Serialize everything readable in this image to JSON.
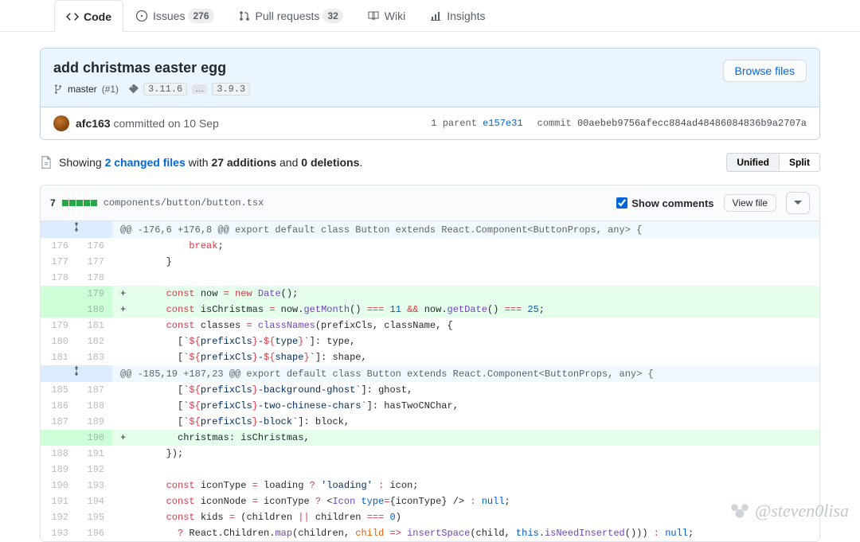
{
  "tabs": {
    "code": "Code",
    "issues": "Issues",
    "issues_count": "276",
    "pulls": "Pull requests",
    "pulls_count": "32",
    "wiki": "Wiki",
    "insights": "Insights"
  },
  "commit": {
    "title": "add christmas easter egg",
    "branch": "master",
    "branch_suffix": "(#1)",
    "tag1": "3.11.6",
    "tag_dots": "…",
    "tag2": "3.9.3",
    "browse_btn": "Browse files",
    "author": "afc163",
    "committed": "committed on 10 Sep",
    "parent_label": "1 parent",
    "parent_sha": "e157e31",
    "commit_label": "commit",
    "sha": "00aebeb9756afecc884ad48486084836b9a2707a"
  },
  "diffbar": {
    "showing": "Showing",
    "files": "2 changed files",
    "with": "with",
    "adds": "27 additions",
    "and": "and",
    "dels": "0 deletions",
    "dot": ".",
    "unified": "Unified",
    "split": "Split"
  },
  "file": {
    "stat": "7",
    "path": "components/button/button.tsx",
    "show_comments": "Show comments",
    "view_file": "View file"
  },
  "hunks": {
    "h1": "@@ -176,6 +176,8 @@ export default class Button extends React.Component<ButtonProps, any> {",
    "h2": "@@ -185,19 +187,23 @@ export default class Button extends React.Component<ButtonProps, any> {"
  },
  "lines": [
    {
      "l": "176",
      "r": "176",
      "t": "normal",
      "m": " ",
      "html": "          <span class='kw'>break</span>;"
    },
    {
      "l": "177",
      "r": "177",
      "t": "normal",
      "m": " ",
      "html": "      }"
    },
    {
      "l": "178",
      "r": "178",
      "t": "normal",
      "m": " ",
      "html": ""
    },
    {
      "l": "",
      "r": "179",
      "t": "add",
      "m": "+",
      "html": "      <span class='kw'>const</span> now <span class='k'>=</span> <span class='kw'>new</span> <span class='fn'>Date</span>();"
    },
    {
      "l": "",
      "r": "180",
      "t": "add",
      "m": "+",
      "html": "      <span class='kw'>const</span> isChristmas <span class='k'>=</span> now.<span class='fn'>getMonth</span>() <span class='k'>===</span> <span class='n'>11</span> <span class='k'>&amp;&amp;</span> now.<span class='fn'>getDate</span>() <span class='k'>===</span> <span class='n'>25</span>;"
    },
    {
      "l": "179",
      "r": "181",
      "t": "normal",
      "m": " ",
      "html": "      <span class='kw'>const</span> classes <span class='k'>=</span> <span class='fn'>classNames</span>(prefixCls, className, {"
    },
    {
      "l": "180",
      "r": "182",
      "t": "normal",
      "m": " ",
      "html": "        [<span class='s'>`<span class='k'>${</span>prefixCls<span class='k'>}</span>-<span class='k'>${</span>type<span class='k'>}</span>`</span>]: type,"
    },
    {
      "l": "181",
      "r": "183",
      "t": "normal",
      "m": " ",
      "html": "        [<span class='s'>`<span class='k'>${</span>prefixCls<span class='k'>}</span>-<span class='k'>${</span>shape<span class='k'>}</span>`</span>]: shape,"
    }
  ],
  "lines2": [
    {
      "l": "185",
      "r": "187",
      "t": "normal",
      "m": " ",
      "html": "        [<span class='s'>`<span class='k'>${</span>prefixCls<span class='k'>}</span>-background-ghost`</span>]: ghost,"
    },
    {
      "l": "186",
      "r": "188",
      "t": "normal",
      "m": " ",
      "html": "        [<span class='s'>`<span class='k'>${</span>prefixCls<span class='k'>}</span>-two-chinese-chars`</span>]: hasTwoCNChar,"
    },
    {
      "l": "187",
      "r": "189",
      "t": "normal",
      "m": " ",
      "html": "        [<span class='s'>`<span class='k'>${</span>prefixCls<span class='k'>}</span>-block`</span>]: block,"
    },
    {
      "l": "",
      "r": "190",
      "t": "add",
      "m": "+",
      "html": "        christmas: isChristmas,"
    },
    {
      "l": "188",
      "r": "191",
      "t": "normal",
      "m": " ",
      "html": "      });"
    },
    {
      "l": "189",
      "r": "192",
      "t": "normal",
      "m": " ",
      "html": ""
    },
    {
      "l": "190",
      "r": "193",
      "t": "normal",
      "m": " ",
      "html": "      <span class='kw'>const</span> iconType <span class='k'>=</span> loading <span class='k'>?</span> <span class='s'>'loading'</span> <span class='k'>:</span> icon;"
    },
    {
      "l": "191",
      "r": "194",
      "t": "normal",
      "m": " ",
      "html": "      <span class='kw'>const</span> iconNode <span class='k'>=</span> iconType <span class='k'>?</span> &lt;<span class='fn'>Icon</span> <span class='blue'>type</span><span class='k'>=</span>{iconType} /&gt; <span class='k'>:</span> <span class='n'>null</span>;"
    },
    {
      "l": "192",
      "r": "195",
      "t": "normal",
      "m": " ",
      "html": "      <span class='kw'>const</span> kids <span class='k'>=</span> (children <span class='k'>||</span> children <span class='k'>===</span> <span class='n'>0</span>)"
    },
    {
      "l": "193",
      "r": "196",
      "t": "normal",
      "m": " ",
      "html": "        <span class='k'>?</span> React.Children.<span class='fn'>map</span>(children, <span class='v'>child</span> <span class='k'>=&gt;</span> <span class='fn'>insertSpace</span>(child, <span class='n'>this</span>.<span class='fn'>isNeedInserted</span>())) <span class='k'>:</span> <span class='n'>null</span>;"
    }
  ],
  "watermark": "@steven0lisa"
}
